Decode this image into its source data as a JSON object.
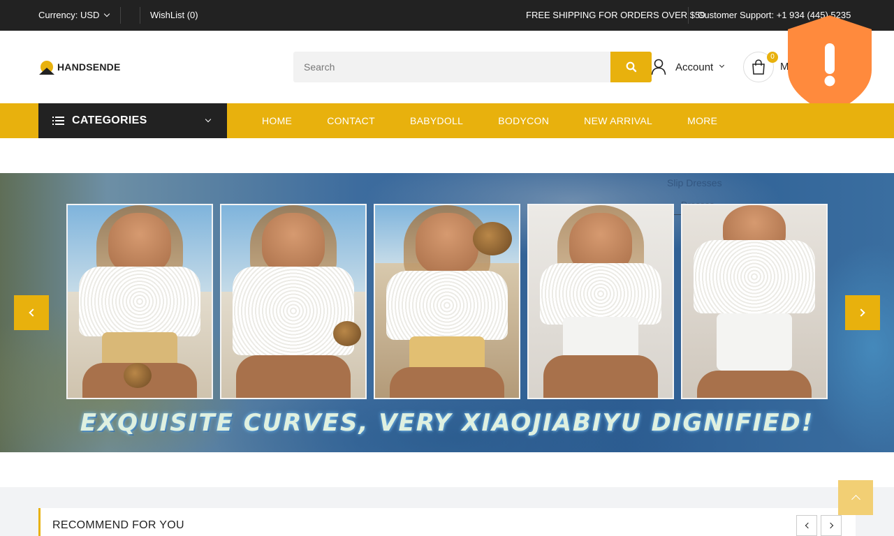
{
  "topbar": {
    "currency_label": "Currency: USD",
    "wishlist_label": "WishList (0)",
    "shipping_text": "FREE SHIPPING FOR ORDERS OVER $59",
    "support_text": "Customer Support: +1 934 (445) 5235"
  },
  "header": {
    "logo_text": "HANDSENDE",
    "search_placeholder": "Search",
    "account_label": "Account",
    "cart_count": "0",
    "cart_label_partial": "M"
  },
  "nav": {
    "categories_label": "CATEGORIES",
    "links": [
      "HOME",
      "CONTACT",
      "BABYDOLL",
      "BODYCON",
      "NEW ARRIVAL",
      "MORE"
    ]
  },
  "hero": {
    "caption": "EXQUISITE CURVES, VERY XIAOJIABIYU DIGNIFIED!",
    "overlay_text_1": "Slip Dresses",
    "overlay_text_2": "Dresses"
  },
  "recommend": {
    "title": "RECOMMEND FOR YOU"
  },
  "colors": {
    "accent": "#e8b10d",
    "dark": "#222222",
    "alert_shield": "#ff8a3d"
  }
}
